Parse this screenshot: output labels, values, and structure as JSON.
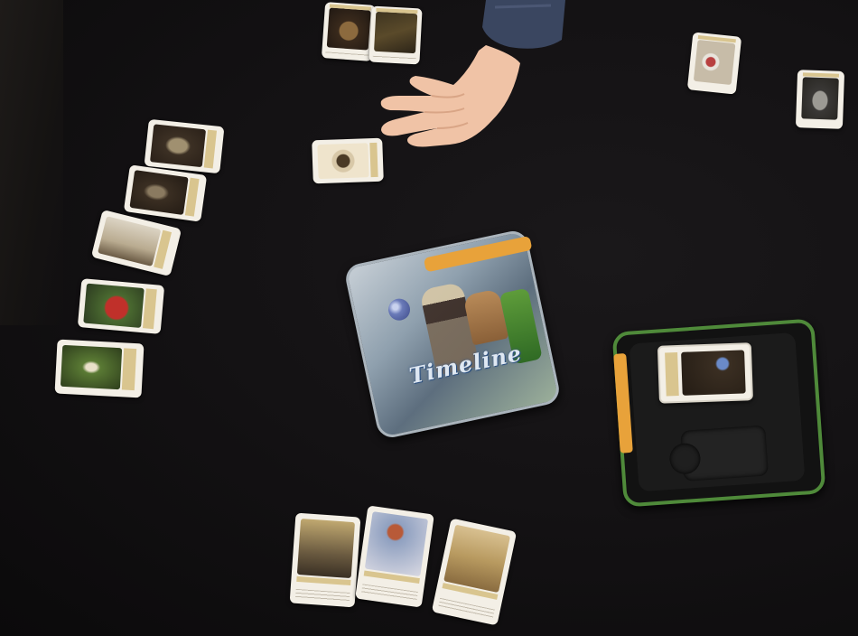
{
  "scene": {
    "surface_color": "#111011",
    "tin_logo_text": "Timeline",
    "tin_accent_color": "#e8a23a",
    "box_rim_color": "#4f8a3a"
  },
  "cards": {
    "top_row": [
      "planet-card",
      "forest-card"
    ],
    "top_right": [
      "molecule-card",
      "satellite-card"
    ],
    "in_hand": "round-artifact-card",
    "left_column": [
      "fossil-card",
      "beetle-card",
      "figures-card",
      "tomato-card",
      "plant-card"
    ],
    "bottom_row": [
      "stonehenge-card",
      "balloon-card",
      "temple-card"
    ],
    "deck_top": "planet-card"
  }
}
